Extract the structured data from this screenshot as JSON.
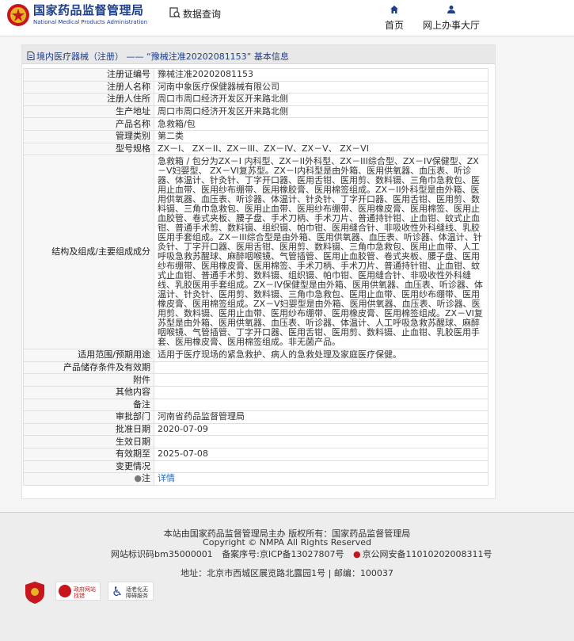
{
  "header": {
    "logo_cn": "国家药品监督管理局",
    "logo_en": "National Medical Products Administration",
    "query_label": "数据查询",
    "nav_home": "首页",
    "nav_hall": "网上办事大厅"
  },
  "breadcrumb": {
    "category": "境内医疗器械（注册）",
    "separator": "——",
    "title": "“豫械注准20202081153” 基本信息"
  },
  "rows": [
    {
      "label": "注册证编号",
      "value": "豫械注准20202081153"
    },
    {
      "label": "注册人名称",
      "value": "河南中象医疗保健器械有限公司"
    },
    {
      "label": "注册人住所",
      "value": "周口市周口经济开发区开来路北侧"
    },
    {
      "label": "生产地址",
      "value": "周口市周口经济开发区开来路北侧"
    },
    {
      "label": "产品名称",
      "value": "急救箱/包"
    },
    {
      "label": "管理类别",
      "value": "第二类"
    },
    {
      "label": "型号规格",
      "value": "ZX－I、 ZX－II、ZX－III、ZX－IV、ZX－V、 ZX－VI"
    }
  ],
  "structure": {
    "label": "结构及组成/主要组成成分",
    "value": "急救箱 / 包分为ZX－I 内科型、ZX－II外科型、ZX－III综合型、ZX－IV保健型、ZX－V妇婴型、 ZX－VI复苏型。ZX－I内科型是由外箱、医用供氧器、血压表、听诊器、体温计、针灸针、丁字开口器、医用舌钳、医用剪、数料镊、三角巾急救包、医用止血带、医用纱布绷带、医用橡胶膏、医用棉签组成。ZX－II外科型是由外箱、医用供氧器、血压表、听诊器、体温计、针灸针、丁字开口器、医用舌钳、医用剪、数料镊、三角巾急救包、医用止血带、医用纱布绷带、医用橡皮膏、医用棉签、医用止血胶管、卷式夹板、腰子盘、手术刀柄、手术刀片、普通持针钳、止血钳、蚊式止血钳、普通手术剪、数料镊、组织镊、帕巾钳、医用缝合针、非吸收性外科缝线、乳胶医用手套组成。ZX－III综合型是由外箱、医用供氧器、血压表、听诊器、体温计、针灸针、丁字开口器、医用舌钳、医用剪、数料镊、三角巾急救包、医用止血带、人工呼吸急救苏醒球、麻醉咽喉镜、气管插管、医用止血胶管、卷式夹板、腰子盘、医用纱布绷带、医用橡皮膏、医用棉签、手术刀柄、手术刀片、普通持针钳、止血钳、蚊式止血钳、普通手术剪、数料镊、组织镊、帕巾钳、医用缝合针、非吸收性外科缝线、乳胶医用手套组成。ZX－IV保健型是由外箱、医用供氧器、血压表、听诊器、体温计、针灸针、医用剪、数料镊、三角巾急救包、医用止血带、医用纱布绷带、医用橡皮膏、医用棉签组成。ZX－V妇婴型是由外箱、医用供氧器、血压表、听诊器、医用剪、数料镊、医用止血带、医用纱布绷带、医用橡皮膏、医用棉签组成。ZX－VI复苏型是由外箱、医用供氧器、血压表、听诊器、体温计、人工呼吸急救苏醒球、麻醉咽喉镜、气管插管、丁字开口器、医用舌钳、医用剪、数料镊、止血钳、乳胶医用手套、医用橡皮膏、医用棉签组成。非无菌产品。"
  },
  "rows2": [
    {
      "label": "适用范围/预期用途",
      "value": "适用于医疗现场的紧急救护、病人的急救处理及家庭医疗保健。"
    },
    {
      "label": "产品储存条件及有效期",
      "value": ""
    },
    {
      "label": "附件",
      "value": ""
    },
    {
      "label": "其他内容",
      "value": ""
    },
    {
      "label": "备注",
      "value": ""
    },
    {
      "label": "审批部门",
      "value": "河南省药品监督管理局"
    },
    {
      "label": "批准日期",
      "value": "2020-07-09"
    },
    {
      "label": "生效日期",
      "value": ""
    },
    {
      "label": "有效期至",
      "value": "2025-07-08"
    },
    {
      "label": "变更情况",
      "value": ""
    }
  ],
  "note": {
    "label": "注",
    "link": "详情"
  },
  "footer": {
    "line1": "本站由国家药品监督管理局主办 版权所有：国家药品监督管理局",
    "line2": "Copyright © NMPA All Rights Reserved",
    "site_id": "网站标识码bm35000001",
    "icp": "备案序号:京ICP备13027807号",
    "police": "京公网安备11010202008311号",
    "address": "地址：北京市西城区展览路北露园1号 | 邮编：100037",
    "badge2_text": "政府网站找错",
    "badge3_text": "适老化无障碍服务"
  }
}
